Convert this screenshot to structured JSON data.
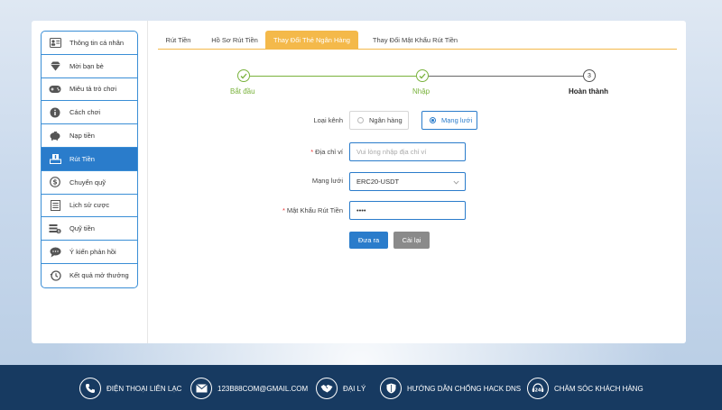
{
  "sidebar": {
    "items": [
      {
        "label": "Thông tin cá nhân",
        "icon": "id-card-icon"
      },
      {
        "label": "Mời bạn bè",
        "icon": "diamond-icon"
      },
      {
        "label": "Miêu tả trò chơi",
        "icon": "gamepad-icon"
      },
      {
        "label": "Cách chơi",
        "icon": "info-icon"
      },
      {
        "label": "Nạp tiền",
        "icon": "piggy-bank-icon"
      },
      {
        "label": "Rút Tiền",
        "icon": "withdraw-icon",
        "active": true
      },
      {
        "label": "Chuyển quỹ",
        "icon": "dollar-icon"
      },
      {
        "label": "Lịch sử cược",
        "icon": "history-list-icon"
      },
      {
        "label": "Quỹ tiền",
        "icon": "wallet-icon"
      },
      {
        "label": "Ý kiến phản hồi",
        "icon": "chat-icon"
      },
      {
        "label": "Kết quả mở thưởng",
        "icon": "clock-history-icon"
      }
    ]
  },
  "tabs": [
    {
      "label": "Rút Tiền"
    },
    {
      "label": "Hồ Sơ Rút Tiền"
    },
    {
      "label": "Thay Đổi Thẻ Ngân Hàng",
      "active": true
    },
    {
      "label": "Thay Đổi Mật Khẩu Rút Tiền"
    }
  ],
  "steps": [
    {
      "label": "Bắt đầu",
      "status": "done"
    },
    {
      "label": "Nhập",
      "status": "done"
    },
    {
      "label": "Hoàn thành",
      "status": "todo",
      "number": "3"
    }
  ],
  "form": {
    "channel_label": "Loại kênh",
    "channel_options": [
      "Ngân hàng",
      "Mạng lưới"
    ],
    "channel_selected": "Mạng lưới",
    "address_label": "Địa chỉ ví",
    "address_placeholder": "Vui lòng nhập địa chỉ ví",
    "network_label": "Mạng lưới",
    "network_value": "ERC20-USDT",
    "password_label": "Mật Khẩu Rút Tiền",
    "password_value": "••••",
    "submit_label": "Đưa ra",
    "reset_label": "Cài lại"
  },
  "footer": {
    "items": [
      {
        "label": "ĐIỆN THOẠI LIÊN LẠC",
        "icon": "phone-icon"
      },
      {
        "label": "123B88COM@GMAIL.COM",
        "icon": "email-icon"
      },
      {
        "label": "ĐẠI LÝ",
        "icon": "handshake-icon"
      },
      {
        "label": "HƯỚNG DẪN CHỐNG HACK DNS",
        "icon": "shield-icon"
      },
      {
        "label": "CHĂM SÓC KHÁCH HÀNG",
        "icon": "support-24-icon"
      }
    ]
  },
  "colors": {
    "primary": "#2a7ccb",
    "accent_tab": "#f4b94a",
    "step_done": "#79b23b",
    "footer_bg": "#173a61"
  }
}
